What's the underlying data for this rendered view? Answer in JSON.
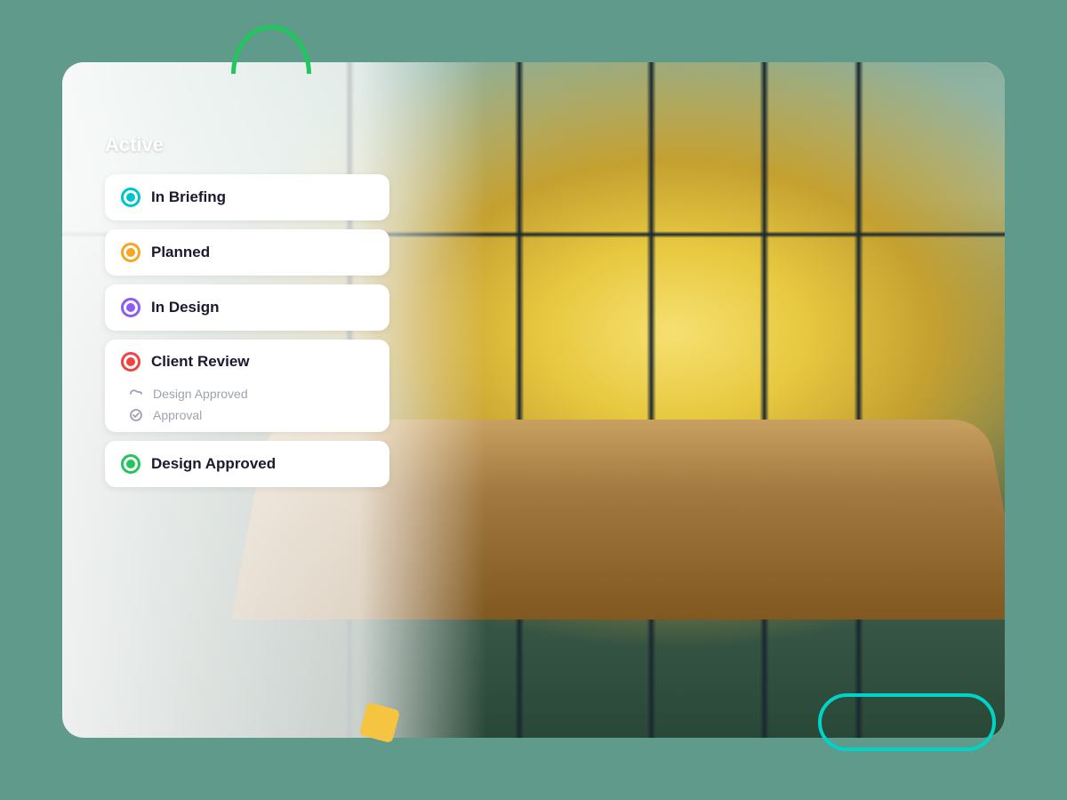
{
  "page": {
    "background_color": "#5f9a8a"
  },
  "status_panel": {
    "active_label": "Active",
    "items": [
      {
        "id": "in-briefing",
        "label": "In Briefing",
        "dot_color": "#00c4cc",
        "dot_class": "dot-briefing",
        "expanded": false,
        "sub_items": []
      },
      {
        "id": "planned",
        "label": "Planned",
        "dot_color": "#f5a623",
        "dot_class": "dot-planned",
        "expanded": false,
        "sub_items": []
      },
      {
        "id": "in-design",
        "label": "In Design",
        "dot_color": "#8b5cf6",
        "dot_class": "dot-design",
        "expanded": false,
        "sub_items": []
      },
      {
        "id": "client-review",
        "label": "Client Review",
        "dot_color": "#ef4444",
        "dot_class": "dot-review",
        "expanded": true,
        "sub_items": [
          {
            "icon": "path",
            "label": "Design Approved"
          },
          {
            "icon": "check",
            "label": "Approval"
          }
        ]
      },
      {
        "id": "design-approved",
        "label": "Design Approved",
        "dot_color": "#22c55e",
        "dot_class": "dot-approved",
        "expanded": false,
        "sub_items": []
      }
    ]
  },
  "decorations": {
    "green_arc": "top-arc-decoration",
    "teal_pill": "bottom-pill-decoration",
    "yellow_square": "yellow-square-decoration"
  }
}
